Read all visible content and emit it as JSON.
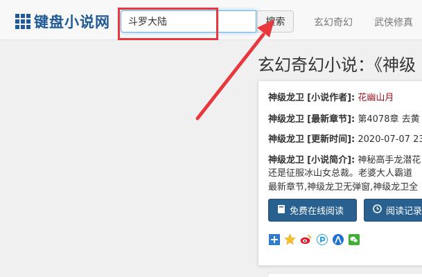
{
  "header": {
    "logo_text": "键盘小说网",
    "search": {
      "value": "斗罗大陆",
      "placeholder": ""
    },
    "search_button": "搜索",
    "nav": [
      "玄幻奇幻",
      "武侠修真"
    ]
  },
  "page": {
    "title": "玄幻奇幻小说：《神级"
  },
  "book": {
    "name": "神级龙卫",
    "author_label": "[小说作者]:",
    "author": "花幽山月",
    "latest_label": "[最新章节]:",
    "latest": "第4078章 去黄",
    "updated_label": "[更新时间]:",
    "updated": "2020-07-07 23",
    "intro_label": "[小说简介]:",
    "intro_lines": [
      "神秘高手龙潜花",
      "还是征服冰山女总裁。老婆大人霸道",
      "最新章节,神级龙卫无弹窗,神级龙卫全"
    ]
  },
  "buttons": {
    "read_free": "免费在线阅读",
    "read_history": "阅读记录"
  },
  "colors": {
    "brand": "#1f5a96",
    "author": "#a0161e",
    "primary_button": "#286090",
    "highlight_box": "#e8383d"
  },
  "share_icons": [
    "plus-square-icon",
    "qzone-icon",
    "weibo-icon",
    "pengyou-icon",
    "renren-icon",
    "wechat-icon"
  ]
}
